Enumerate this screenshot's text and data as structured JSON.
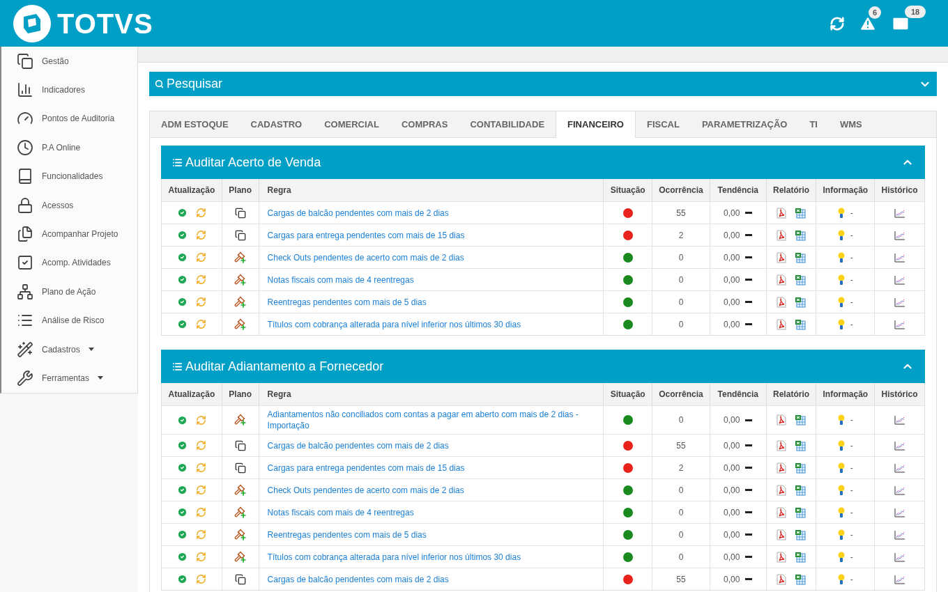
{
  "header": {
    "logo": "TOTVS",
    "alerts_badge": "6",
    "messages_badge": "18"
  },
  "sidebar": {
    "items": [
      {
        "label": "Gestão",
        "has_menu": false
      },
      {
        "label": "Indicadores",
        "has_menu": false
      },
      {
        "label": "Pontos de Auditoria",
        "has_menu": false
      },
      {
        "label": "P.A Online",
        "has_menu": false
      },
      {
        "label": "Funcionalidades",
        "has_menu": false
      },
      {
        "label": "Acessos",
        "has_menu": false
      },
      {
        "label": "Acompanhar Projeto",
        "has_menu": false
      },
      {
        "label": "Acomp. Atividades",
        "has_menu": false
      },
      {
        "label": "Plano de Ação",
        "has_menu": false
      },
      {
        "label": "Análise de Risco",
        "has_menu": false
      },
      {
        "label": "Cadastros",
        "has_menu": true
      },
      {
        "label": "Ferramentas",
        "has_menu": true
      }
    ]
  },
  "search": {
    "title": "Pesquisar",
    "expanded": false
  },
  "tabs": [
    {
      "label": "ADM ESTOQUE",
      "selected": false
    },
    {
      "label": "CADASTRO",
      "selected": false
    },
    {
      "label": "COMERCIAL",
      "selected": false
    },
    {
      "label": "COMPRAS",
      "selected": false
    },
    {
      "label": "CONTABILIDADE",
      "selected": false
    },
    {
      "label": "FINANCEIRO",
      "selected": true
    },
    {
      "label": "FISCAL",
      "selected": false
    },
    {
      "label": "PARAMETRIZAÇÃO",
      "selected": false
    },
    {
      "label": "TI",
      "selected": false
    },
    {
      "label": "WMS",
      "selected": false
    }
  ],
  "sections": [
    {
      "title": "Auditar Acerto de Venda",
      "expanded": true,
      "columns": [
        "Atualização",
        "Plano",
        "Regra",
        "Situação",
        "Ocorrência",
        "Tendência",
        "Relatório",
        "Informação",
        "Histórico"
      ],
      "rows": [
        {
          "kind": "documents",
          "rule": "Cargas de balcão pendentes com mais de 2 dias",
          "color": "#e8221c",
          "occurrence": "55",
          "trend": "0,00",
          "info": "-"
        },
        {
          "kind": "documents",
          "rule": "Cargas para entrega pendentes com mais de 15 dias",
          "color": "#e8221c",
          "occurrence": "2",
          "trend": "0,00",
          "info": "-"
        },
        {
          "kind": "action",
          "rule": "Check Outs pendentes de acerto com mais de 2 dias",
          "color": "#1a8a1f",
          "occurrence": "0",
          "trend": "0,00",
          "info": "-"
        },
        {
          "kind": "action",
          "rule": "Notas fiscais com mais de 4 reentregas",
          "color": "#1a8a1f",
          "occurrence": "0",
          "trend": "0,00",
          "info": "-"
        },
        {
          "kind": "action",
          "rule": "Reentregas pendentes com mais de 5 dias",
          "color": "#1a8a1f",
          "occurrence": "0",
          "trend": "0,00",
          "info": "-"
        },
        {
          "kind": "action",
          "rule": "Títulos com cobrança alterada para nível inferior nos últimos 30 dias",
          "color": "#1a8a1f",
          "occurrence": "0",
          "trend": "0,00",
          "info": "-"
        }
      ]
    },
    {
      "title": "Auditar Adiantamento a Fornecedor",
      "expanded": true,
      "columns": [
        "Atualização",
        "Plano",
        "Regra",
        "Situação",
        "Ocorrência",
        "Tendência",
        "Relatório",
        "Informação",
        "Histórico"
      ],
      "rows": [
        {
          "kind": "action",
          "rule": "Adiantamentos não conciliados com contas a pagar em aberto com mais de 2 dias - Importação",
          "color": "#1a8a1f",
          "occurrence": "0",
          "trend": "0,00",
          "info": "-"
        },
        {
          "kind": "documents",
          "rule": "Cargas de balcão pendentes com mais de 2 dias",
          "color": "#e8221c",
          "occurrence": "55",
          "trend": "0,00",
          "info": "-"
        },
        {
          "kind": "documents",
          "rule": "Cargas para entrega pendentes com mais de 15 dias",
          "color": "#e8221c",
          "occurrence": "2",
          "trend": "0,00",
          "info": "-"
        },
        {
          "kind": "action",
          "rule": "Check Outs pendentes de acerto com mais de 2 dias",
          "color": "#1a8a1f",
          "occurrence": "0",
          "trend": "0,00",
          "info": "-"
        },
        {
          "kind": "action",
          "rule": "Notas fiscais com mais de 4 reentregas",
          "color": "#1a8a1f",
          "occurrence": "0",
          "trend": "0,00",
          "info": "-"
        },
        {
          "kind": "action",
          "rule": "Reentregas pendentes com mais de 5 dias",
          "color": "#1a8a1f",
          "occurrence": "0",
          "trend": "0,00",
          "info": "-"
        },
        {
          "kind": "action",
          "rule": "Títulos com cobrança alterada para nível inferior nos últimos 30 dias",
          "color": "#1a8a1f",
          "occurrence": "0",
          "trend": "0,00",
          "info": "-"
        },
        {
          "kind": "documents",
          "rule": "Cargas de balcão pendentes com mais de 2 dias",
          "color": "#e8221c",
          "occurrence": "55",
          "trend": "0,00",
          "info": "-"
        }
      ]
    }
  ]
}
